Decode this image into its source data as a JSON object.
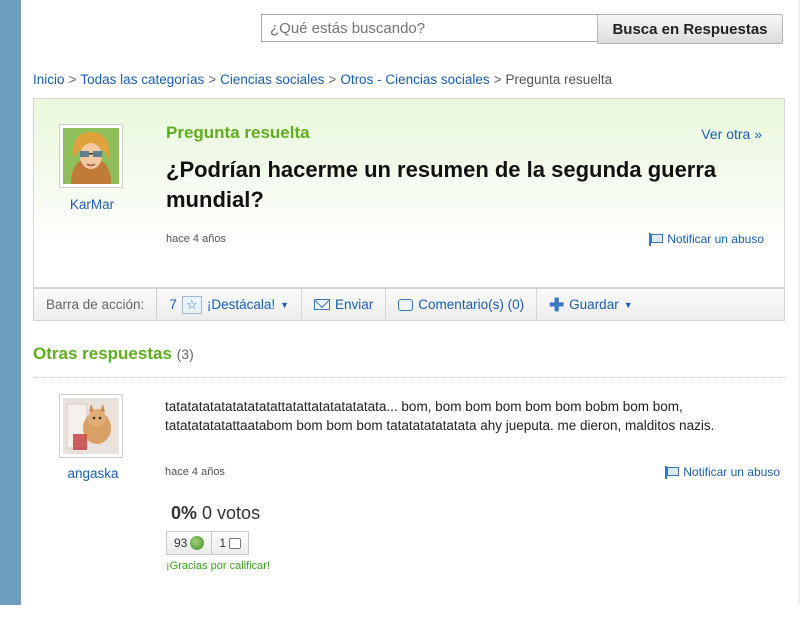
{
  "search": {
    "placeholder": "¿Qué estás buscando?",
    "button_label": "Busca en Respuestas"
  },
  "breadcrumb": [
    "Inicio",
    "Todas las categorías",
    "Ciencias sociales",
    "Otros - Ciencias sociales",
    "Pregunta resuelta"
  ],
  "breadcrumb_separator": ">",
  "question": {
    "status": "Pregunta resuelta",
    "see_other": "Ver otra »",
    "title": "¿Podrían hacerme un resumen de la segunda guerra mundial?",
    "time": "hace 4 años",
    "report": "Notificar un abuso",
    "user": "KarMar"
  },
  "action_bar": {
    "label": "Barra de acción:",
    "stars": "7",
    "highlight": "¡Destácala!",
    "send": "Enviar",
    "comments": "Comentario(s) (0)",
    "save": "Guardar"
  },
  "answers": {
    "heading": "Otras respuestas",
    "count": "(3)",
    "items": [
      {
        "user": "angaska",
        "text": "tatatatatatatatatatattatattatatatatatata... bom, bom bom bom bom bom bobm bom bom, tatatatatatattaatabom bom bom bom tatatatatatatata ahy jueputa. me dieron, malditos nazis.",
        "time": "hace 4 años",
        "report": "Notificar un abuso",
        "percent": "0%",
        "votes": "0 votos",
        "thumbs_up": "93",
        "thumbs_down": "1",
        "thanks": "¡Gracias por calificar!"
      }
    ]
  },
  "colors": {
    "accent_green": "#5fae1d",
    "link_blue": "#1a5fb4",
    "rail_blue": "#6d9ec0"
  }
}
